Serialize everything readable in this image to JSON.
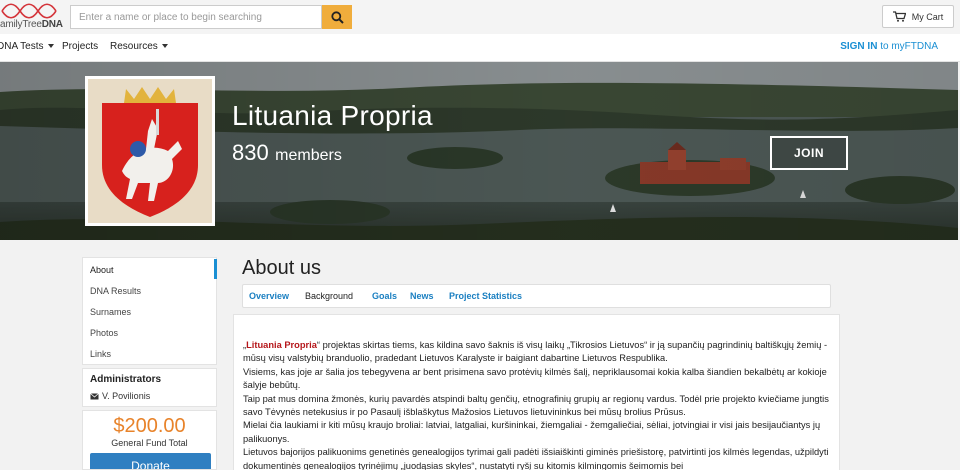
{
  "header": {
    "logo_prefix": "amily",
    "logo_mid": "Tree",
    "logo_suffix": "DNA",
    "search_placeholder": "Enter a name or place to begin searching",
    "cart_label": "My Cart"
  },
  "nav": {
    "items": [
      {
        "label": "DNA Tests"
      },
      {
        "label": "Projects"
      },
      {
        "label": "Resources"
      }
    ],
    "signin_bold": "SIGN IN",
    "signin_rest": "to myFTDNA"
  },
  "banner": {
    "group_name": "Lituania Propria",
    "member_count": "830",
    "member_label": "members",
    "join_label": "JOIN"
  },
  "sidebar": {
    "items": [
      {
        "label": "About"
      },
      {
        "label": "DNA Results"
      },
      {
        "label": "Surnames"
      },
      {
        "label": "Photos"
      },
      {
        "label": "Links"
      }
    ],
    "administrators_title": "Administrators",
    "admin_name": "V. Povilionis",
    "fund_amount": "$200.00",
    "fund_label": "General Fund Total",
    "donate_label": "Donate"
  },
  "main": {
    "title": "About us",
    "tabs": [
      {
        "label": "Overview"
      },
      {
        "label": "Background"
      },
      {
        "label": "Goals"
      },
      {
        "label": "News"
      },
      {
        "label": "Project Statistics"
      }
    ],
    "highlight": "Lituania Propria",
    "p1_open": "„",
    "p1_rest": "“ projektas skirtas tiems, kas kildina savo šaknis iš visų laikų „Tikrosios Lietuvos“ ir ją supančių pagrindinių baltiškųjų žemių - mūsų visų valstybių branduolio, pradedant Lietuvos Karalyste ir baigiant dabartine Lietuvos Respublika.",
    "p2": "Visiems, kas joje ar šalia jos tebegyvena ar bent prisimena savo protėvių kilmės šalį, nepriklausomai kokia kalba šiandien bekalbėtų ar kokioje šalyje bebūtų.",
    "p3": "Taip pat mus domina žmonės, kurių pavardės atspindi baltų genčių, etnografinių grupių ar regionų vardus. Todėl prie projekto kviečiame jungtis savo Tėvynės netekusius ir po Pasaulį išblaškytus Mažosios Lietuvos lietuvininkus bei mūsų brolius Prūsus.",
    "p4": "Mielai čia laukiami ir kiti mūsų kraujo broliai: latviai, latgaliai, kuršininkai, žiemgaliai - žemgaliečiai, sėliai, jotvingiai ir visi jais besijaučiantys jų palikuonys.",
    "p5": "Lietuvos bajorijos palikuonims genetinės genealogijos tyrimai gali padėti išsiaiškinti giminės priešistorę, patvirtinti jos kilmės legendas, užpildyti dokumentinės genealogijos tyrinėjimų „juodąsias skyles“, nustatyti ryšį su kitomis kilmingomis šeimomis bei"
  },
  "colors": {
    "accent_blue": "#1a8fd3",
    "search_button": "#f0ad3c",
    "fund_orange": "#e8832a",
    "highlight_red": "#b5161a",
    "donate_blue": "#2f7fc1"
  }
}
